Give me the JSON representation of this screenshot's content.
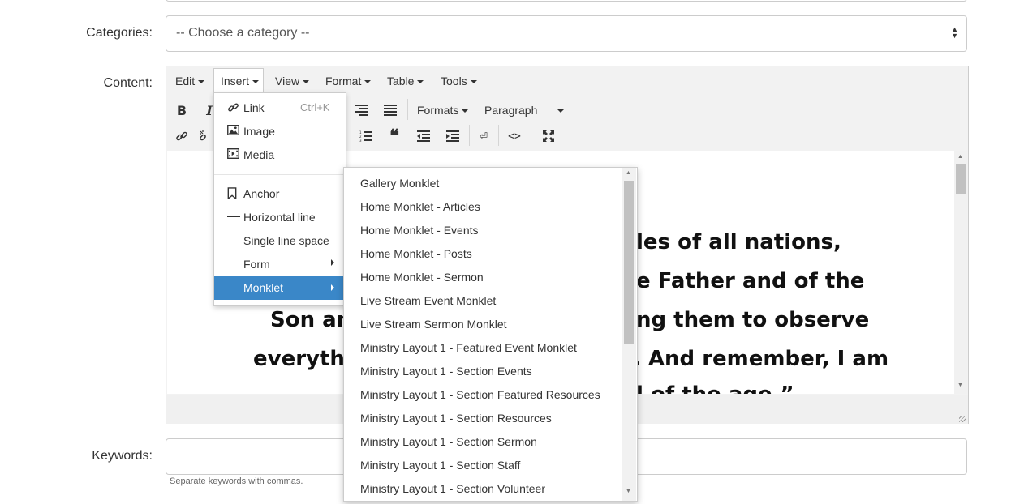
{
  "form": {
    "categories_label": "Categories:",
    "categories_value": "-- Choose a category --",
    "content_label": "Content:",
    "keywords_label": "Keywords:",
    "keywords_value": "",
    "keywords_hint": "Separate keywords with commas."
  },
  "editor": {
    "menubar": [
      {
        "label": "Edit"
      },
      {
        "label": "Insert"
      },
      {
        "label": "View"
      },
      {
        "label": "Format"
      },
      {
        "label": "Table"
      },
      {
        "label": "Tools"
      }
    ],
    "toolbar": {
      "bold_label": "B",
      "italic_label": "I",
      "formats_label": "Formats",
      "paragraph_label": "Paragraph"
    },
    "content_lines": [
      "les of all nations,",
      "e Father and of the",
      "Son an",
      "ng them to observe",
      "everythi",
      ". And remember, I am",
      "l of the age.”"
    ]
  },
  "insert_menu": {
    "items": [
      {
        "label": "Link",
        "shortcut": "Ctrl+K",
        "icon": "link-icon"
      },
      {
        "label": "Image",
        "icon": "image-icon"
      },
      {
        "label": "Media",
        "icon": "media-icon"
      },
      {
        "label": "Anchor",
        "icon": "bookmark-icon"
      },
      {
        "label": "Horizontal line",
        "icon": "horizontal-line-icon"
      },
      {
        "label": "Single line space"
      },
      {
        "label": "Form"
      },
      {
        "label": "Monklet"
      }
    ],
    "highlight_color": "#3a87c8"
  },
  "monklet_menu": {
    "items": [
      "Gallery Monklet",
      "Home Monklet - Articles",
      "Home Monklet - Events",
      "Home Monklet - Posts",
      "Home Monklet - Sermon",
      "Live Stream Event Monklet",
      "Live Stream Sermon Monklet",
      "Ministry Layout 1 - Featured Event Monklet",
      "Ministry Layout 1 - Section Events",
      "Ministry Layout 1 - Section Featured Resources",
      "Ministry Layout 1 - Section Resources",
      "Ministry Layout 1 - Section Sermon",
      "Ministry Layout 1 - Section Staff",
      "Ministry Layout 1 - Section Volunteer"
    ]
  }
}
